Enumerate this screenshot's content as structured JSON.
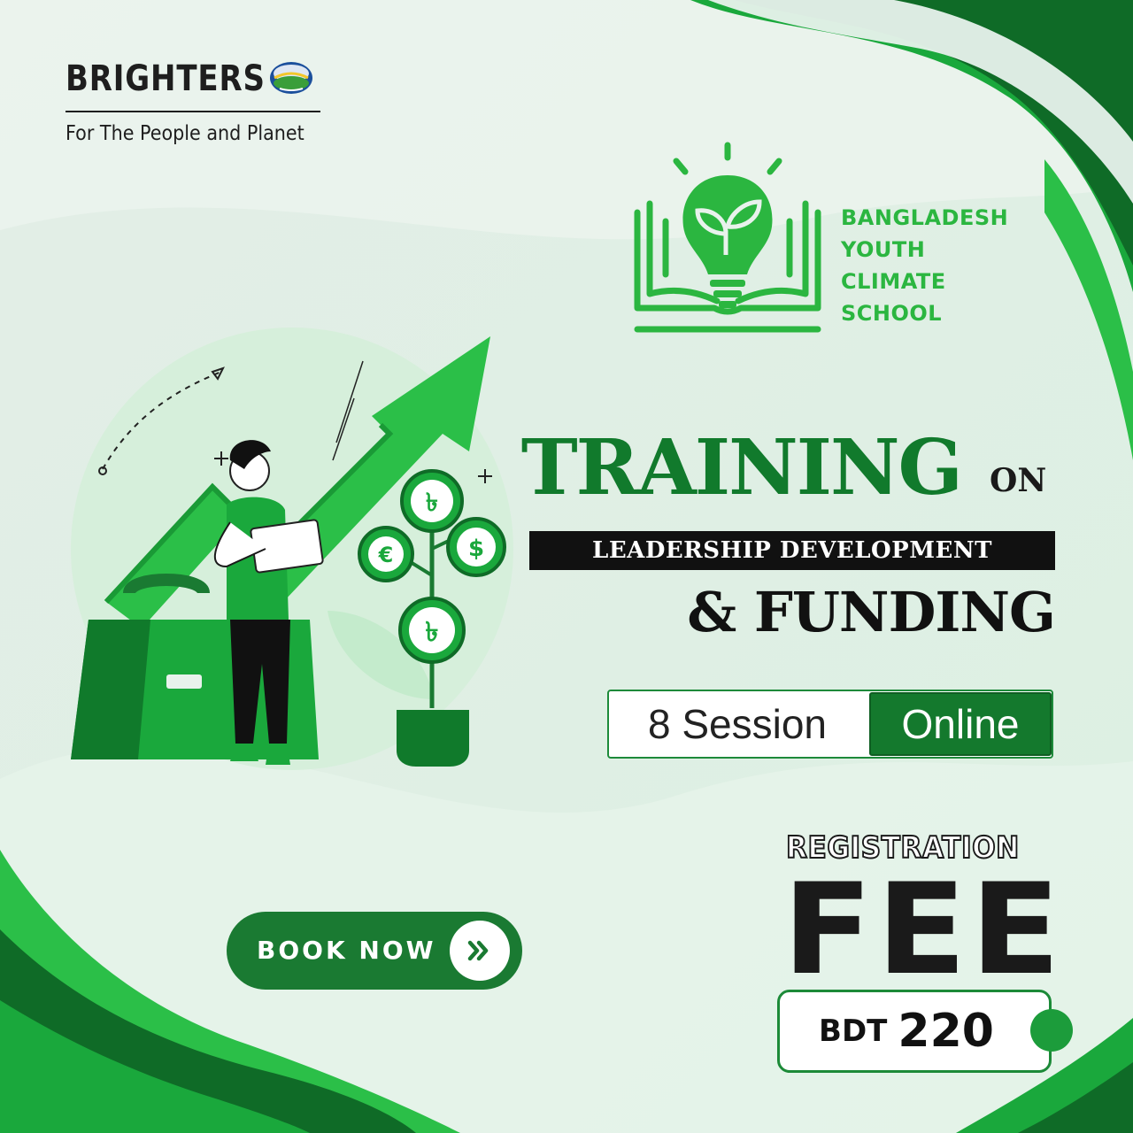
{
  "brand": {
    "name": "BRIGHTERS",
    "tagline": "For The People and Planet"
  },
  "school": {
    "lines": [
      "BANGLADESH",
      "YOUTH",
      "CLIMATE",
      "SCHOOL"
    ]
  },
  "headline": {
    "word1": "TRAINING",
    "word2": "ON",
    "band": "LEADERSHIP DEVELOPMENT",
    "line3": "& FUNDING"
  },
  "details": {
    "sessions": "8 Session",
    "mode": "Online"
  },
  "cta": {
    "label": "BOOK NOW"
  },
  "fee": {
    "label_top": "REGISTRATION",
    "label_big": "FEE",
    "currency": "BDT",
    "amount": "220"
  },
  "colors": {
    "primary_green": "#14792d",
    "bright_green": "#2bb640",
    "background": "#e8f2ec",
    "dark": "#111111"
  },
  "icons": [
    "globe-logo-icon",
    "lightbulb-book-icon",
    "chevron-right-icon",
    "taka-coin-icon",
    "euro-coin-icon",
    "dollar-coin-icon",
    "briefcase-icon",
    "growth-arrow-icon"
  ]
}
